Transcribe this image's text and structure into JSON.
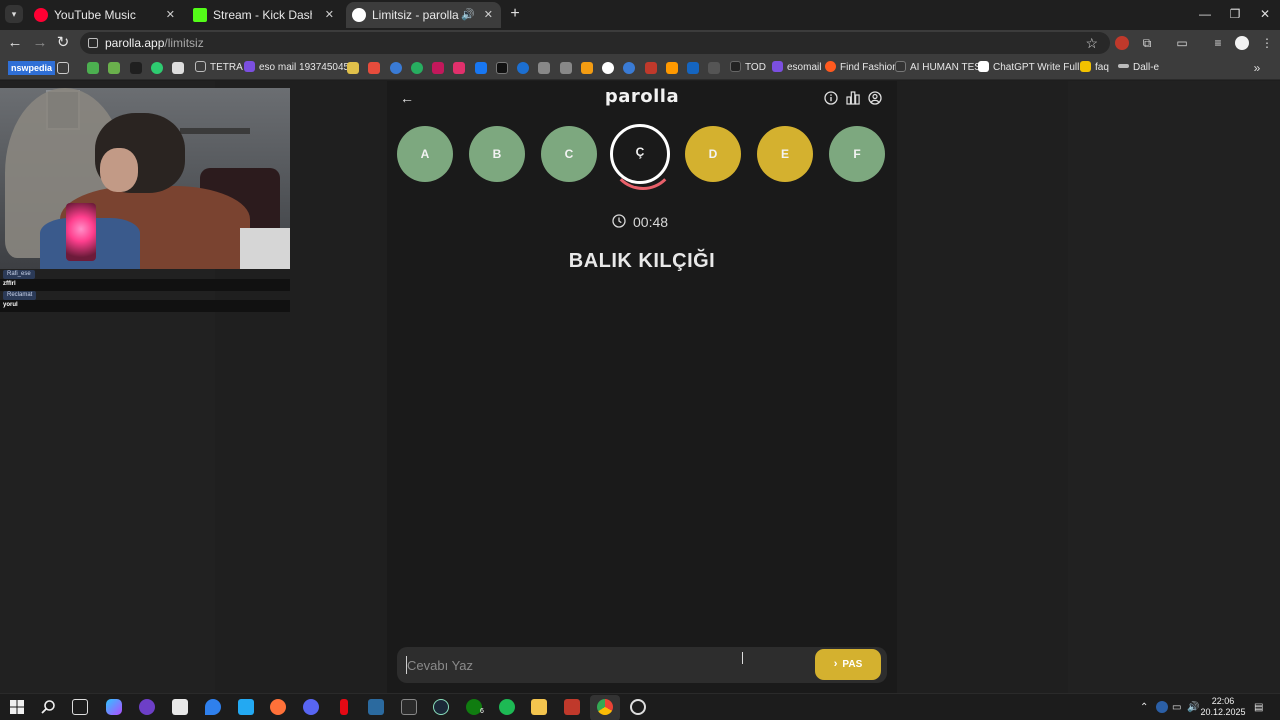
{
  "browser": {
    "tabs": [
      {
        "title": "YouTube Music",
        "active": false,
        "favicon_color": "#ff0033"
      },
      {
        "title": "Stream - Kick Dashboard",
        "active": false,
        "favicon_color": "#53fc18"
      },
      {
        "title": "Limitsiz - parolla - Kelime o",
        "active": true,
        "favicon_color": "#ffffff"
      }
    ],
    "new_tab": "+",
    "window_controls": {
      "minimize": "—",
      "restore": "❐",
      "close": "✕"
    },
    "address": {
      "domain": "parolla.app",
      "path": "/limitsiz"
    },
    "bookmarks": [
      {
        "label": "nswpedia",
        "color": "#2f6fd6"
      },
      {
        "label": "TETRA",
        "color": "#aaaaaa"
      },
      {
        "label": "eso mail 193745045...",
        "color": "#7b4fe0"
      },
      {
        "label": "TOD",
        "color": "#222222"
      },
      {
        "label": "esomail",
        "color": "#7b4fe0"
      },
      {
        "label": "Find Fashion",
        "color": "#ff5a1f"
      },
      {
        "label": "AI HUMAN TEST",
        "color": "#333333"
      },
      {
        "label": "ChatGPT Write Full...",
        "color": "#ffffff"
      },
      {
        "label": "faq",
        "color": "#f2c200"
      },
      {
        "label": "Dall-e",
        "color": "#bbbbbb"
      }
    ]
  },
  "stream_overlay": {
    "chat": [
      {
        "user": "Rafi_ese",
        "message": "zfflrl"
      },
      {
        "user": "Reclamat",
        "message": "yorul"
      }
    ]
  },
  "game": {
    "brand": "parolla",
    "back_icon": "arrow-left-icon",
    "header_icons": [
      "info-icon",
      "stats-icon",
      "user-icon"
    ],
    "letters": [
      {
        "letter": "A",
        "state": "correct"
      },
      {
        "letter": "B",
        "state": "correct"
      },
      {
        "letter": "C",
        "state": "correct"
      },
      {
        "letter": "Ç",
        "state": "current"
      },
      {
        "letter": "D",
        "state": "passed"
      },
      {
        "letter": "E",
        "state": "passed"
      },
      {
        "letter": "F",
        "state": "correct"
      }
    ],
    "colors": {
      "correct": "#7da87f",
      "passed": "#d4b12f",
      "current_ring": "#ffffff",
      "timer_ring": "#e8606a"
    },
    "timer": "00:48",
    "question": "BALIK KILÇIĞI",
    "answer": {
      "placeholder": "Cevabı Yaz",
      "value": ""
    },
    "pass_button": "PAS"
  },
  "taskbar": {
    "time": "22:06",
    "date": "20.12.2025",
    "badge": "6"
  }
}
